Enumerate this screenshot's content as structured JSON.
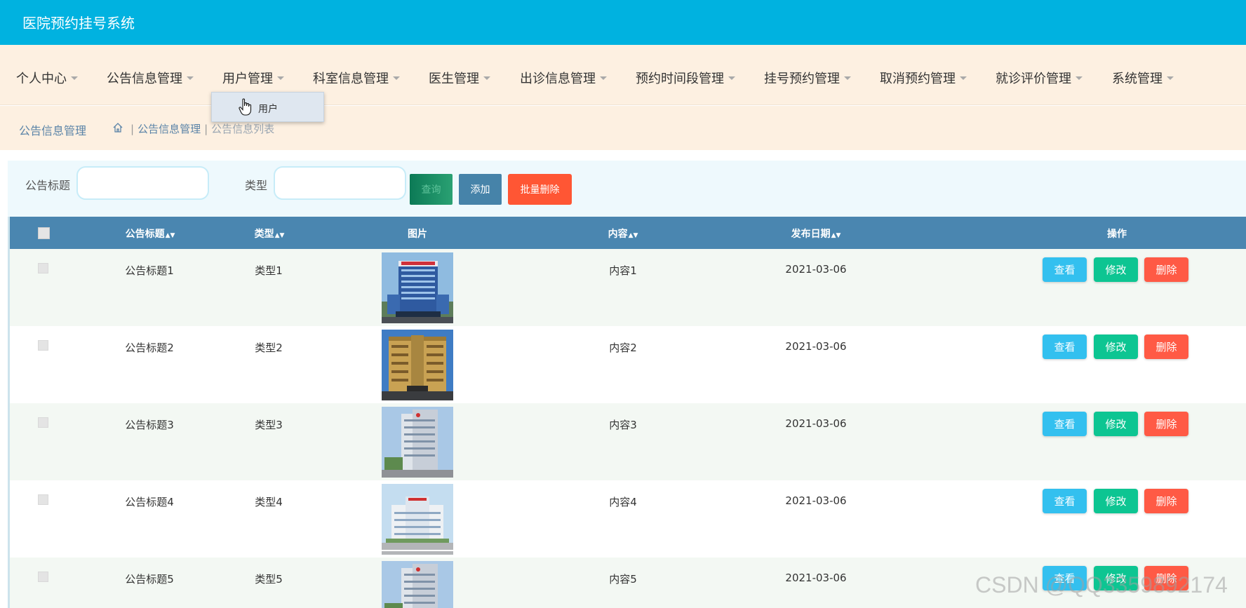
{
  "app": {
    "title": "医院预约挂号系统"
  },
  "nav": {
    "items": [
      {
        "label": "个人中心"
      },
      {
        "label": "公告信息管理"
      },
      {
        "label": "用户管理"
      },
      {
        "label": "科室信息管理"
      },
      {
        "label": "医生管理"
      },
      {
        "label": "出诊信息管理"
      },
      {
        "label": "预约时间段管理"
      },
      {
        "label": "挂号预约管理"
      },
      {
        "label": "取消预约管理"
      },
      {
        "label": "就诊评价管理"
      },
      {
        "label": "系统管理"
      }
    ],
    "open_dropdown": {
      "parent": "用户管理",
      "items": [
        "用户"
      ]
    }
  },
  "breadcrumb": {
    "title": "公告信息管理",
    "path": [
      "公告信息管理",
      "公告信息列表"
    ]
  },
  "search": {
    "title_label": "公告标题",
    "title_value": "",
    "type_label": "类型",
    "type_value": "",
    "search_button": "查询",
    "add_button": "添加",
    "batch_delete_button": "批量删除"
  },
  "table": {
    "columns": [
      "公告标题",
      "类型",
      "图片",
      "内容",
      "发布日期",
      "操作"
    ],
    "sortable": [
      true,
      true,
      false,
      true,
      true,
      false
    ],
    "rows": [
      {
        "title": "公告标题1",
        "type": "类型1",
        "content": "内容1",
        "date": "2021-03-06"
      },
      {
        "title": "公告标题2",
        "type": "类型2",
        "content": "内容2",
        "date": "2021-03-06"
      },
      {
        "title": "公告标题3",
        "type": "类型3",
        "content": "内容3",
        "date": "2021-03-06"
      },
      {
        "title": "公告标题4",
        "type": "类型4",
        "content": "内容4",
        "date": "2021-03-06"
      },
      {
        "title": "公告标题5",
        "type": "类型5",
        "content": "内容5",
        "date": "2021-03-06"
      }
    ],
    "actions": {
      "view": "查看",
      "edit": "修改",
      "delete": "删除"
    }
  },
  "watermark": "CSDN @QQ3359892174",
  "colors": {
    "header": "#00b2e0",
    "nav_bg": "#fdf0e1",
    "table_header": "#4a86b0",
    "view": "#33c0ef",
    "edit": "#0dc592",
    "delete": "#ff5a45",
    "add": "#4683a9",
    "batch_delete": "#ff5634"
  }
}
